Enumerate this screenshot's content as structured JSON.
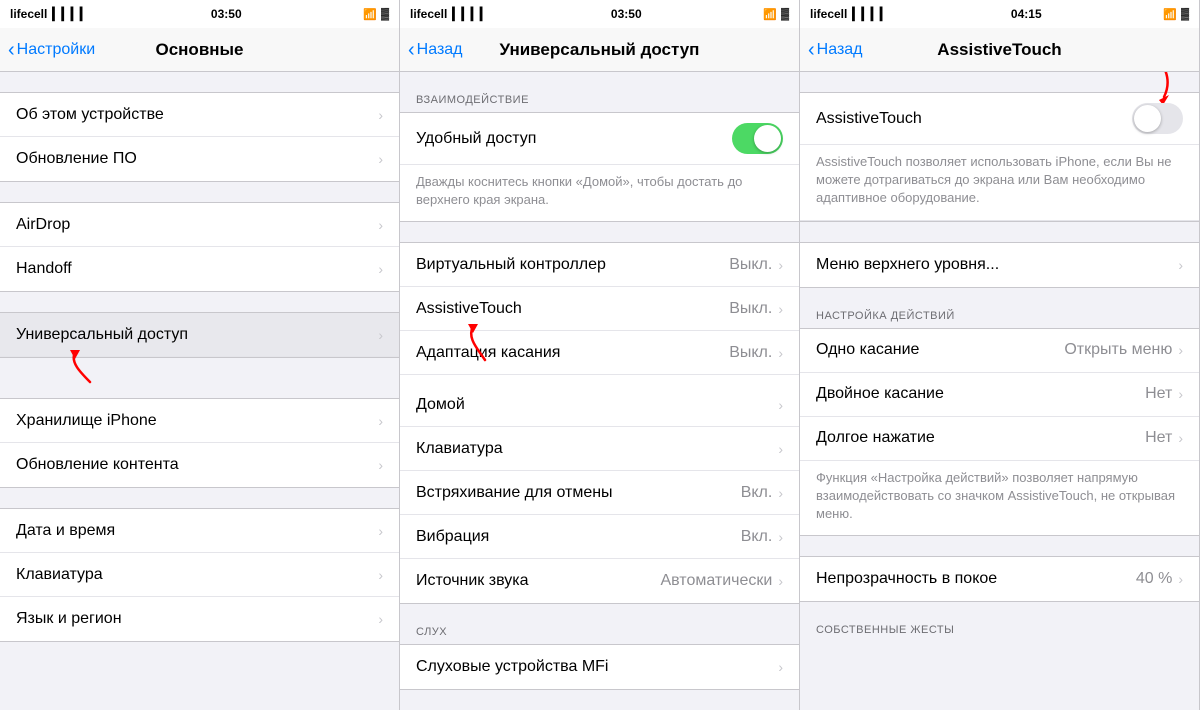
{
  "panels": [
    {
      "id": "panel1",
      "status": {
        "carrier": "lifecell",
        "time": "03:50",
        "signal": "▎▎▎▎",
        "wifi": "wifi",
        "battery": "🔋"
      },
      "nav": {
        "back_label": "Настройки",
        "title": "Основные"
      },
      "groups": [
        {
          "rows": [
            {
              "label": "Об этом устройстве",
              "value": "",
              "chevron": true
            },
            {
              "label": "Обновление ПО",
              "value": "",
              "chevron": true
            }
          ]
        },
        {
          "rows": [
            {
              "label": "AirDrop",
              "value": "",
              "chevron": true
            },
            {
              "label": "Handoff",
              "value": "",
              "chevron": true
            }
          ]
        },
        {
          "rows": [
            {
              "label": "Универсальный доступ",
              "value": "",
              "chevron": true
            }
          ]
        },
        {
          "rows": [
            {
              "label": "Хранилище iPhone",
              "value": "",
              "chevron": true
            },
            {
              "label": "Обновление контента",
              "value": "",
              "chevron": true
            }
          ]
        },
        {
          "rows": [
            {
              "label": "Дата и время",
              "value": "",
              "chevron": true
            },
            {
              "label": "Клавиатура",
              "value": "",
              "chevron": true
            },
            {
              "label": "Язык и регион",
              "value": "",
              "chevron": true
            }
          ]
        }
      ]
    },
    {
      "id": "panel2",
      "status": {
        "carrier": "lifecell",
        "time": "03:50",
        "signal": "▎▎▎▎",
        "wifi": "wifi",
        "battery": "🔋"
      },
      "nav": {
        "back_label": "Назад",
        "title": "Универсальный доступ"
      },
      "section_interaction": "ВЗАИМОДЕЙСТВИЕ",
      "interaction_rows": [
        {
          "type": "toggle",
          "label": "Удобный доступ",
          "toggle_state": "on"
        },
        {
          "type": "desc",
          "text": "Дважды коснитесь кнопки «Домой», чтобы достать до верхнего края экрана."
        }
      ],
      "main_rows": [
        {
          "label": "Виртуальный контроллер",
          "value": "Выкл.",
          "chevron": true
        },
        {
          "label": "AssistiveTouch",
          "value": "Выкл.",
          "chevron": true
        },
        {
          "label": "Адаптация касания",
          "value": "Выкл.",
          "chevron": true
        },
        {
          "label": "Домой",
          "value": "",
          "chevron": true
        },
        {
          "label": "Клавиатура",
          "value": "",
          "chevron": true
        },
        {
          "label": "Встряхивание для отмены",
          "value": "Вкл.",
          "chevron": true
        },
        {
          "label": "Вибрация",
          "value": "Вкл.",
          "chevron": true
        },
        {
          "label": "Источник звука",
          "value": "Автоматически",
          "chevron": true
        }
      ],
      "section_hearing": "СЛУХ",
      "hearing_rows": [
        {
          "label": "Слуховые устройства MFi",
          "value": "",
          "chevron": true
        }
      ]
    },
    {
      "id": "panel3",
      "status": {
        "carrier": "lifecell",
        "time": "04:15",
        "signal": "▎▎▎▎",
        "wifi": "wifi",
        "battery": "🔋"
      },
      "nav": {
        "back_label": "Назад",
        "title": "AssistiveTouch"
      },
      "top_section": {
        "label": "AssistiveTouch",
        "toggle_state": "off",
        "desc": "AssistiveTouch позволяет использовать iPhone, если Вы не можете дотрагиваться до экрана или Вам необходимо адаптивное оборудование."
      },
      "menu_row": {
        "label": "Меню верхнего уровня...",
        "chevron": true
      },
      "section_actions": "НАСТРОЙКА ДЕЙСТВИЙ",
      "action_rows": [
        {
          "label": "Одно касание",
          "value": "Открыть меню",
          "chevron": true
        },
        {
          "label": "Двойное касание",
          "value": "Нет",
          "chevron": true
        },
        {
          "label": "Долгое нажатие",
          "value": "Нет",
          "chevron": true
        }
      ],
      "actions_desc": "Функция «Настройка действий» позволяет напрямую взаимодействовать со значком AssistiveTouch, не открывая меню.",
      "opacity_row": {
        "label": "Непрозрачность в покое",
        "value": "40 %",
        "chevron": true
      },
      "section_gestures": "СОБСТВЕННЫЕ ЖЕСТЫ"
    }
  ]
}
